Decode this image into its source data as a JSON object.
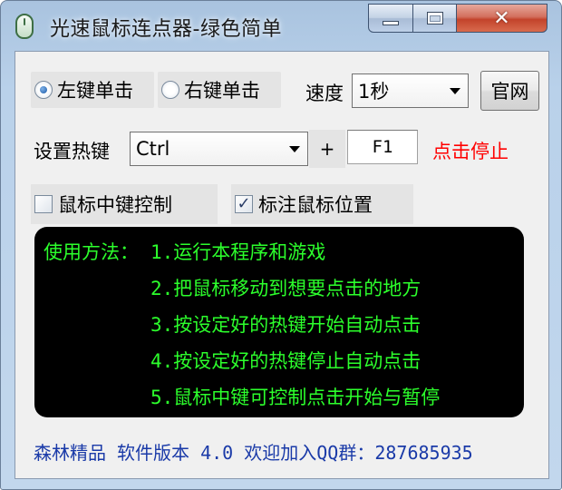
{
  "window": {
    "title": "光速鼠标连点器-绿色简单",
    "close_symbol": "✕",
    "icons": {
      "app": "mouse-icon",
      "minimize": "minimize-icon",
      "maximize": "maximize-icon",
      "close": "close-icon"
    }
  },
  "click_mode": {
    "options": [
      {
        "label": "左键单击",
        "selected": true
      },
      {
        "label": "右键单击",
        "selected": false
      }
    ]
  },
  "speed": {
    "label": "速度",
    "value": "1秒"
  },
  "official_site_button": "官网",
  "hotkey": {
    "label": "设置热键",
    "modifier_value": "Ctrl",
    "plus": "+",
    "key_value": "F1",
    "status_text": "点击停止",
    "status_color": "#ff0000"
  },
  "options": {
    "middle_button_control": {
      "label": "鼠标中键控制",
      "checked": false
    },
    "mark_mouse_position": {
      "label": "标注鼠标位置",
      "checked": true,
      "check_mark": "✓"
    }
  },
  "instructions": {
    "heading": "使用方法：",
    "steps": [
      "1.运行本程序和游戏",
      "2.把鼠标移动到想要点击的地方",
      "3.按设定好的热键开始自动点击",
      "4.按设定好的热键停止自动点击",
      "5.鼠标中键可控制点击开始与暂停"
    ],
    "text_color": "#2cff2c"
  },
  "footer": {
    "text": "森林精品 软件版本 4.0 欢迎加入QQ群：287685935",
    "color": "#1a3aa8"
  }
}
